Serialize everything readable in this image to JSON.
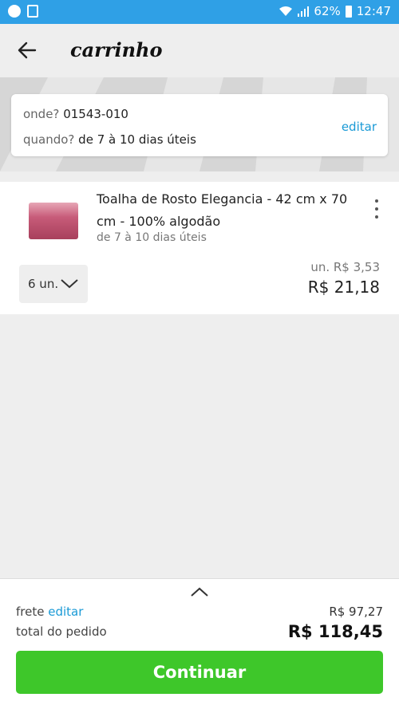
{
  "status_bar": {
    "battery": "62%",
    "time": "12:47"
  },
  "header": {
    "title": "carrinho"
  },
  "delivery": {
    "where_label": "onde?",
    "where_value": "01543-010",
    "when_label": "quando?",
    "when_value": "de 7 à 10 dias úteis",
    "edit_label": "editar"
  },
  "item": {
    "name": "Toalha de Rosto Elegancia - 42 cm x 70 cm - 100% algodão",
    "delivery_days": "de 7 à 10 dias úteis",
    "quantity": "6 un.",
    "unit_price": "un. R$ 3,53",
    "subtotal": "R$ 21,18"
  },
  "summary": {
    "shipping_label": "frete",
    "shipping_edit": "editar",
    "shipping_value": "R$ 97,27",
    "total_label": "total do pedido",
    "total_value": "R$ 118,45",
    "continue_label": "Continuar"
  },
  "colors": {
    "status_bar": "#2fa0e6",
    "link": "#1a9ad6",
    "primary_button": "#3ec72a"
  }
}
